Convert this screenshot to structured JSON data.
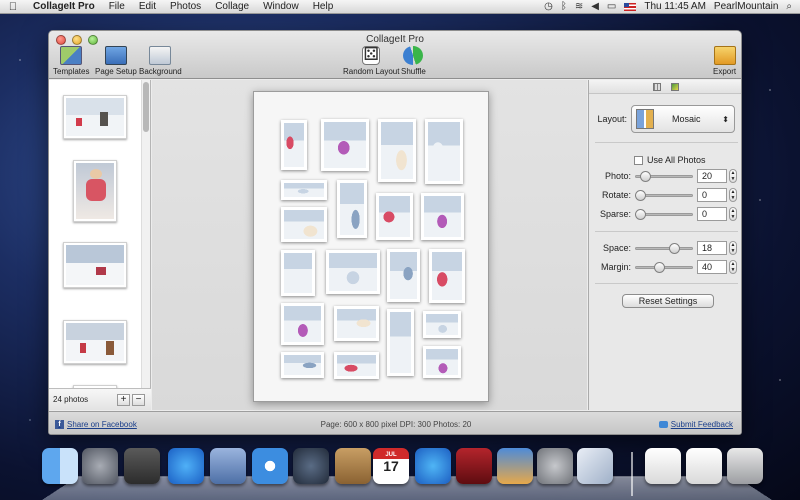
{
  "menubar": {
    "app_name": "CollageIt Pro",
    "menus": [
      "File",
      "Edit",
      "Photos",
      "Collage",
      "Window",
      "Help"
    ],
    "clock": "Thu 11:45 AM",
    "user": "PearlMountain"
  },
  "window": {
    "title": "CollageIt Pro"
  },
  "toolbar": {
    "templates": "Templates",
    "page_setup": "Page Setup",
    "background": "Background",
    "random_layout": "Random Layout",
    "shuffle": "Shuffle",
    "export": "Export"
  },
  "sidebar": {
    "photo_count": "24 photos",
    "add": "+",
    "remove": "−"
  },
  "inspector": {
    "layout_label": "Layout:",
    "layout_value": "Mosaic",
    "use_all_photos": "Use All Photos",
    "photo_label": "Photo:",
    "photo_value": "20",
    "photo_level": 0.1,
    "rotate_label": "Rotate:",
    "rotate_value": "0",
    "rotate_level": 0.0,
    "sparse_label": "Sparse:",
    "sparse_value": "0",
    "sparse_level": 0.0,
    "space_label": "Space:",
    "space_value": "18",
    "space_level": 0.7,
    "margin_label": "Margin:",
    "margin_value": "40",
    "margin_level": 0.4,
    "reset": "Reset Settings"
  },
  "statusbar": {
    "share_facebook": "Share on Facebook",
    "info": "Page: 600 x 800 pixel DPI: 300 Photos: 20",
    "feedback": "Submit Feedback"
  },
  "colors": {
    "photo_palette": [
      "#eef2f6",
      "#c7d4e3",
      "#8aa3c2",
      "#d84b64",
      "#b35bb8",
      "#f1e4d0"
    ]
  },
  "dock": {
    "icons": [
      "finder-icon",
      "launchpad-icon",
      "mission-control-icon",
      "app-store-icon",
      "mail-icon",
      "safari-icon",
      "facetime-icon",
      "address-book-icon",
      "ical-icon",
      "itunes-icon",
      "photo-booth-icon",
      "iphoto-icon",
      "system-preferences-icon",
      "collageit-icon",
      "document-icon",
      "document-icon",
      "trash-icon"
    ],
    "ical_month": "JUL",
    "ical_day": "17"
  }
}
